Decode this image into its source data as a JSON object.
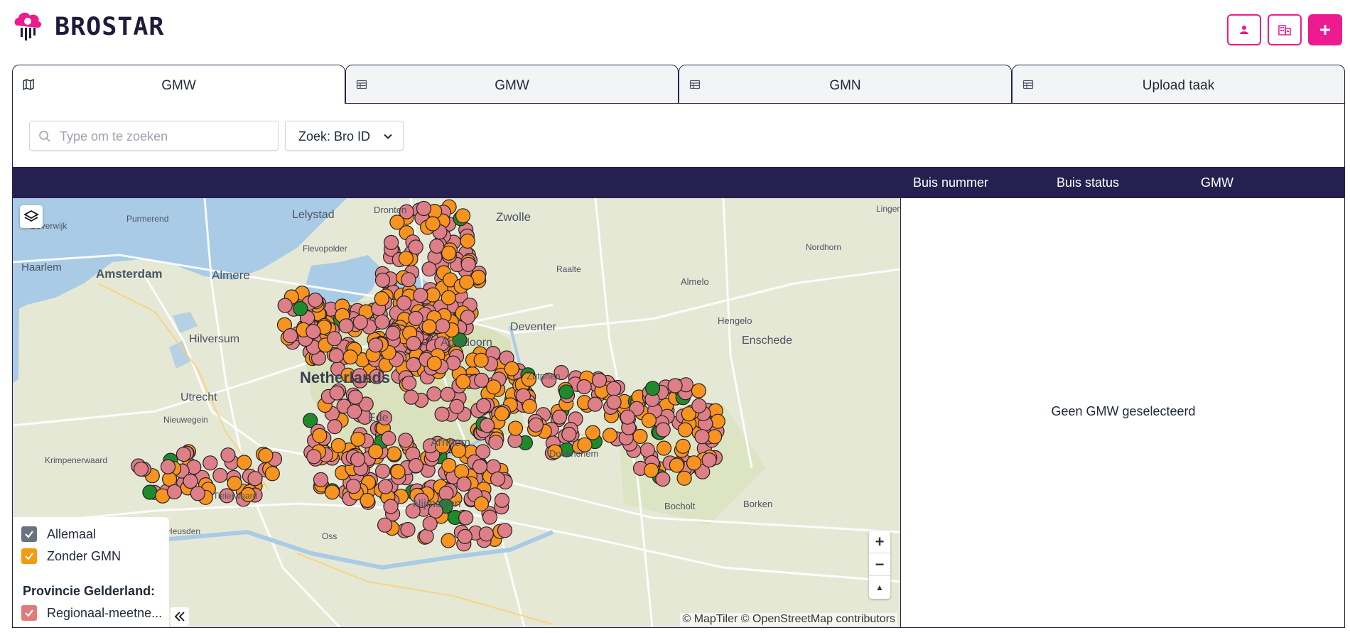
{
  "app": {
    "title": "BROSTAR"
  },
  "header": {
    "buttons": [
      {
        "name": "user-button",
        "icon": "user-icon"
      },
      {
        "name": "organisation-button",
        "icon": "building-icon"
      },
      {
        "name": "add-button",
        "icon": "plus-icon"
      }
    ]
  },
  "tabs": [
    {
      "label": "GMW",
      "icon": "map-icon",
      "active": true
    },
    {
      "label": "GMW",
      "icon": "table-icon",
      "active": false
    },
    {
      "label": "GMN",
      "icon": "table-icon",
      "active": false
    },
    {
      "label": "Upload taak",
      "icon": "table-icon",
      "active": false
    }
  ],
  "search": {
    "placeholder": "Type om te zoeken",
    "value": ""
  },
  "search_by": {
    "label": "Zoek: Bro ID"
  },
  "table": {
    "columns": [
      "Buis nummer",
      "Buis status",
      "GMW"
    ]
  },
  "map": {
    "labels": [
      "Lelystad",
      "Dronten",
      "Zwolle",
      "Beverwijk",
      "Purmerend",
      "Haarlem",
      "Amsterdam",
      "Almere",
      "Flevopolder",
      "Raalte",
      "Lingen",
      "Nordhorn",
      "Hilversum",
      "Apeldoorn",
      "Deventer",
      "Almelo",
      "Hengelo",
      "Enschede",
      "Netherlands",
      "Utrecht",
      "Zutphen",
      "Nieuwegein",
      "Ede",
      "Krimpenerwaard",
      "Arnhem",
      "Doetinchem",
      "Tielerwaard",
      "Nijmegen",
      "Bocholt",
      "Borken",
      "Heusden",
      "Oss"
    ],
    "attribution": "© MapTiler © OpenStreetMap contributors",
    "zoom_in": "+",
    "zoom_out": "−",
    "compass": "▲"
  },
  "legend": {
    "items": [
      {
        "label": "Allemaal",
        "color": "#6b7280",
        "checked": true
      },
      {
        "label": "Zonder GMN",
        "color": "#f39c12",
        "checked": true
      }
    ],
    "group_title": "Provincie Gelderland:",
    "group_items": [
      {
        "label": "Regionaal-meetne...",
        "color": "#e07b7b",
        "checked": true
      }
    ]
  },
  "detail": {
    "empty_text": "Geen GMW geselecteerd"
  },
  "colors": {
    "accent": "#ec1b8f",
    "navy": "#25204f",
    "orange": "#f59e0b",
    "pink": "#de7f88",
    "green": "#1f8a2b"
  }
}
